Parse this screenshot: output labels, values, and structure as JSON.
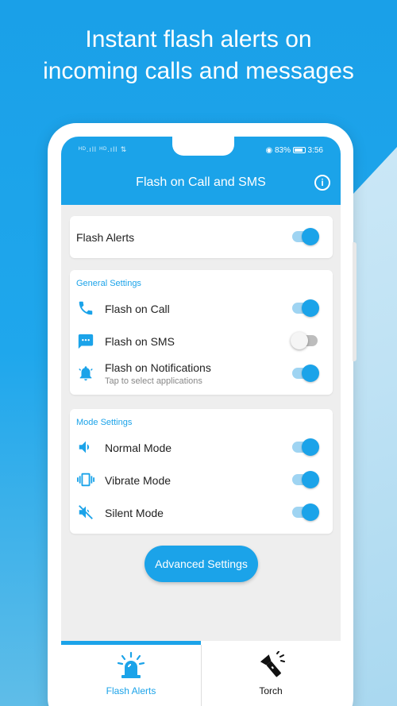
{
  "headline": {
    "line1": "Instant flash alerts on",
    "line2": "incoming calls and messages"
  },
  "status_bar": {
    "left": "ᴴᴰ.ıll ᴴᴰ.ıll ⇅",
    "battery": "83%",
    "time": "3:56"
  },
  "appbar": {
    "title": "Flash on Call and SMS",
    "info_icon": "info-icon"
  },
  "flash_alerts_card": {
    "label": "Flash Alerts",
    "enabled": true
  },
  "general_settings": {
    "title": "General Settings",
    "items": [
      {
        "label": "Flash on Call",
        "icon": "phone-icon",
        "enabled": true
      },
      {
        "label": "Flash on SMS",
        "icon": "sms-icon",
        "enabled": false
      },
      {
        "label": "Flash on Notifications",
        "sublabel": "Tap to select applications",
        "icon": "bell-icon",
        "enabled": true
      }
    ]
  },
  "mode_settings": {
    "title": "Mode Settings",
    "items": [
      {
        "label": "Normal Mode",
        "icon": "volume-icon",
        "enabled": true
      },
      {
        "label": "Vibrate Mode",
        "icon": "vibrate-icon",
        "enabled": true
      },
      {
        "label": "Silent Mode",
        "icon": "mute-icon",
        "enabled": true
      }
    ]
  },
  "advanced_button": "Advanced Settings",
  "bottom_nav": {
    "tabs": [
      {
        "label": "Flash Alerts",
        "icon": "siren-icon",
        "selected": true
      },
      {
        "label": "Torch",
        "icon": "flashlight-icon",
        "selected": false
      }
    ]
  },
  "colors": {
    "accent": "#1ba3e9",
    "background": "#eeeeee"
  }
}
